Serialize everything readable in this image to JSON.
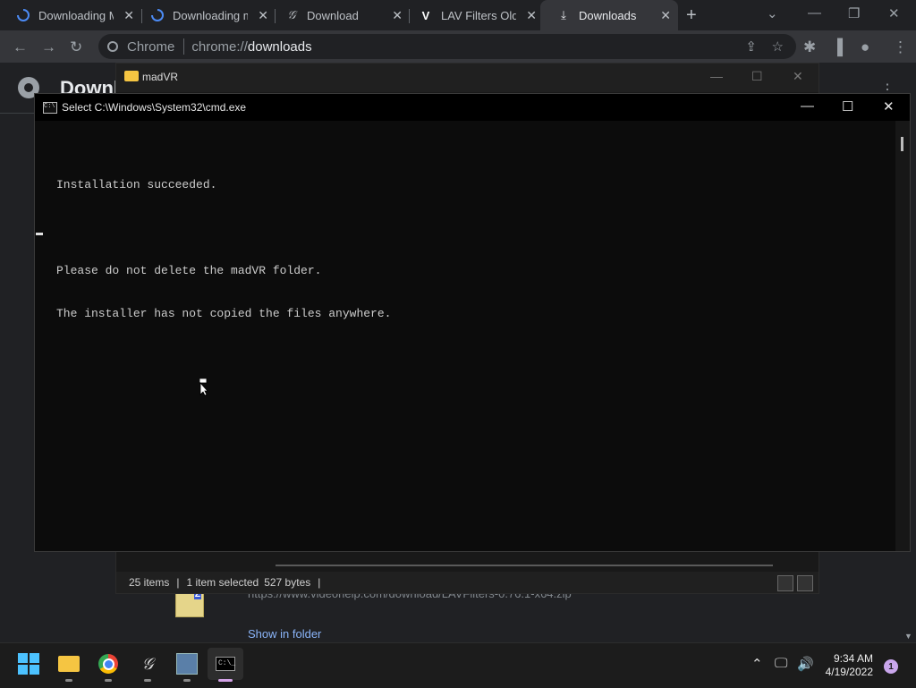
{
  "browser": {
    "tabs": [
      {
        "label": "Downloading M",
        "icon": "loading-spinner-icon",
        "active": false
      },
      {
        "label": "Downloading m",
        "icon": "loading-spinner-icon",
        "active": false
      },
      {
        "label": "Download",
        "icon": "script-logo-icon",
        "active": false
      },
      {
        "label": "LAV Filters Old",
        "icon": "v-logo-icon",
        "active": false
      },
      {
        "label": "Downloads",
        "icon": "download-icon",
        "active": true
      }
    ],
    "omnibox": {
      "site": "Chrome",
      "url_prefix": "chrome://",
      "url_host": "downloads"
    },
    "page_title": "Downl",
    "download_item": {
      "url": "https://www.videohelp.com/download/LAVFilters-0.76.1-x64.zip",
      "show_in_folder": "Show in folder"
    }
  },
  "explorer": {
    "title": "madVR",
    "status": {
      "items": "25 items",
      "selected": "1 item selected",
      "size": "527 bytes"
    }
  },
  "cmd": {
    "title": "Select C:\\Windows\\System32\\cmd.exe",
    "lines": [
      "Installation succeeded.",
      "",
      "Please do not delete the madVR folder.",
      "The installer has not copied the files anywhere."
    ]
  },
  "taskbar": {
    "apps": [
      "start-button",
      "file-explorer",
      "chrome",
      "script-app",
      "installer-app",
      "command-prompt"
    ],
    "clock": {
      "time": "9:34 AM",
      "date": "4/19/2022"
    },
    "notifications": "1"
  }
}
